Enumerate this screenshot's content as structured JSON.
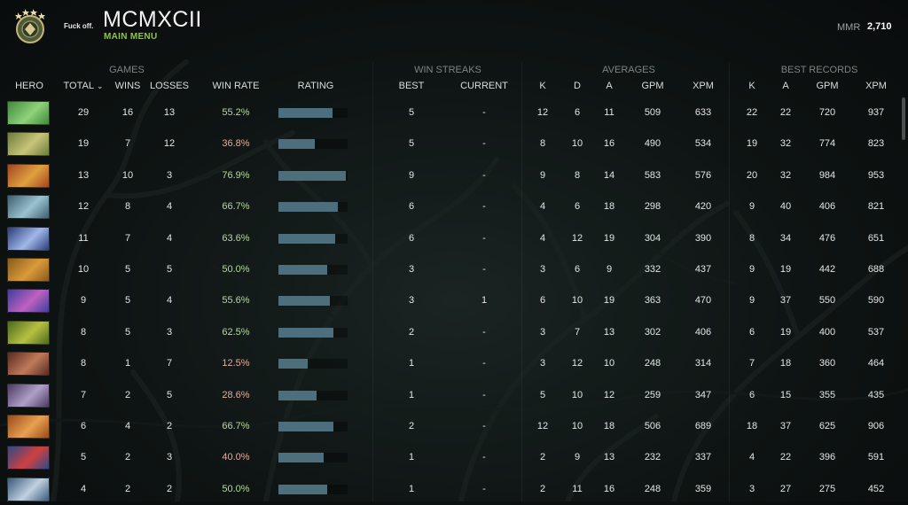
{
  "header": {
    "username_small": "Fuck off.",
    "title": "MCMXCII",
    "subtitle": "MAIN MENU",
    "mmr_label": "MMR",
    "mmr_value": "2,710"
  },
  "groups": {
    "games": "GAMES",
    "win_streaks": "WIN STREAKS",
    "averages": "AVERAGES",
    "best_records": "BEST RECORDS"
  },
  "columns": {
    "hero": "HERO",
    "total": "TOTAL",
    "wins": "WINS",
    "losses": "LOSSES",
    "win_rate": "WIN RATE",
    "rating": "RATING",
    "best": "BEST",
    "current": "CURRENT",
    "avg_k": "K",
    "avg_d": "D",
    "avg_a": "A",
    "avg_gpm": "GPM",
    "avg_xpm": "XPM",
    "best_k": "K",
    "best_a": "A",
    "best_gpm": "GPM",
    "best_xpm": "XPM"
  },
  "colors": {
    "accent_green": "#8ec63f",
    "rating_bar": "#4d6e7c"
  },
  "rows": [
    {
      "hero_colors": [
        "#3f8a3a",
        "#8fd27a"
      ],
      "total": "29",
      "wins": "16",
      "losses": "13",
      "win_rate": "55.2%",
      "rating": 0.78,
      "best": "5",
      "current": "-",
      "k": "12",
      "d": "6",
      "a": "11",
      "gpm": "509",
      "xpm": "633",
      "bk": "22",
      "ba": "22",
      "bgpm": "720",
      "bxpm": "937"
    },
    {
      "hero_colors": [
        "#6b7d3a",
        "#c9c47a"
      ],
      "total": "19",
      "wins": "7",
      "losses": "12",
      "win_rate": "36.8%",
      "rating": 0.52,
      "best": "5",
      "current": "-",
      "k": "8",
      "d": "10",
      "a": "16",
      "gpm": "490",
      "xpm": "534",
      "bk": "19",
      "ba": "32",
      "bgpm": "774",
      "bxpm": "823"
    },
    {
      "hero_colors": [
        "#a3451f",
        "#e0a040"
      ],
      "total": "13",
      "wins": "10",
      "losses": "3",
      "win_rate": "76.9%",
      "rating": 0.98,
      "best": "9",
      "current": "-",
      "k": "9",
      "d": "8",
      "a": "14",
      "gpm": "583",
      "xpm": "576",
      "bk": "20",
      "ba": "32",
      "bgpm": "984",
      "bxpm": "953"
    },
    {
      "hero_colors": [
        "#3c5f70",
        "#9bc2d0"
      ],
      "total": "12",
      "wins": "8",
      "losses": "4",
      "win_rate": "66.7%",
      "rating": 0.86,
      "best": "6",
      "current": "-",
      "k": "4",
      "d": "6",
      "a": "18",
      "gpm": "298",
      "xpm": "420",
      "bk": "9",
      "ba": "40",
      "bgpm": "406",
      "bxpm": "821"
    },
    {
      "hero_colors": [
        "#2c3c7a",
        "#a0b8e8"
      ],
      "total": "11",
      "wins": "7",
      "losses": "4",
      "win_rate": "63.6%",
      "rating": 0.82,
      "best": "6",
      "current": "-",
      "k": "4",
      "d": "12",
      "a": "19",
      "gpm": "304",
      "xpm": "390",
      "bk": "8",
      "ba": "34",
      "bgpm": "476",
      "bxpm": "651"
    },
    {
      "hero_colors": [
        "#8a5a1c",
        "#d99a3a"
      ],
      "total": "10",
      "wins": "5",
      "losses": "5",
      "win_rate": "50.0%",
      "rating": 0.7,
      "best": "3",
      "current": "-",
      "k": "3",
      "d": "6",
      "a": "9",
      "gpm": "332",
      "xpm": "437",
      "bk": "9",
      "ba": "19",
      "bgpm": "442",
      "bxpm": "688"
    },
    {
      "hero_colors": [
        "#3a3fa0",
        "#c060c0"
      ],
      "total": "9",
      "wins": "5",
      "losses": "4",
      "win_rate": "55.6%",
      "rating": 0.74,
      "best": "3",
      "current": "1",
      "k": "6",
      "d": "10",
      "a": "19",
      "gpm": "363",
      "xpm": "470",
      "bk": "9",
      "ba": "37",
      "bgpm": "550",
      "bxpm": "590"
    },
    {
      "hero_colors": [
        "#4a6a1f",
        "#b8c040"
      ],
      "total": "8",
      "wins": "5",
      "losses": "3",
      "win_rate": "62.5%",
      "rating": 0.79,
      "best": "2",
      "current": "-",
      "k": "3",
      "d": "7",
      "a": "13",
      "gpm": "302",
      "xpm": "406",
      "bk": "6",
      "ba": "19",
      "bgpm": "400",
      "bxpm": "537"
    },
    {
      "hero_colors": [
        "#5a2a20",
        "#c07a5a"
      ],
      "total": "8",
      "wins": "1",
      "losses": "7",
      "win_rate": "12.5%",
      "rating": 0.42,
      "best": "1",
      "current": "-",
      "k": "3",
      "d": "12",
      "a": "10",
      "gpm": "248",
      "xpm": "314",
      "bk": "7",
      "ba": "18",
      "bgpm": "360",
      "bxpm": "464"
    },
    {
      "hero_colors": [
        "#4a3a60",
        "#b0a0c8"
      ],
      "total": "7",
      "wins": "2",
      "losses": "5",
      "win_rate": "28.6%",
      "rating": 0.55,
      "best": "1",
      "current": "-",
      "k": "5",
      "d": "10",
      "a": "12",
      "gpm": "259",
      "xpm": "347",
      "bk": "6",
      "ba": "15",
      "bgpm": "355",
      "bxpm": "435"
    },
    {
      "hero_colors": [
        "#9a4a1a",
        "#e8a050"
      ],
      "total": "6",
      "wins": "4",
      "losses": "2",
      "win_rate": "66.7%",
      "rating": 0.79,
      "best": "2",
      "current": "-",
      "k": "12",
      "d": "10",
      "a": "18",
      "gpm": "506",
      "xpm": "689",
      "bk": "18",
      "ba": "37",
      "bgpm": "625",
      "bxpm": "906"
    },
    {
      "hero_colors": [
        "#2a4a8a",
        "#d04040"
      ],
      "total": "5",
      "wins": "2",
      "losses": "3",
      "win_rate": "40.0%",
      "rating": 0.65,
      "best": "1",
      "current": "-",
      "k": "2",
      "d": "9",
      "a": "13",
      "gpm": "232",
      "xpm": "337",
      "bk": "4",
      "ba": "22",
      "bgpm": "396",
      "bxpm": "591"
    },
    {
      "hero_colors": [
        "#3a5a7a",
        "#c0d0e0"
      ],
      "total": "4",
      "wins": "2",
      "losses": "2",
      "win_rate": "50.0%",
      "rating": 0.7,
      "best": "1",
      "current": "-",
      "k": "2",
      "d": "11",
      "a": "16",
      "gpm": "248",
      "xpm": "359",
      "bk": "3",
      "ba": "27",
      "bgpm": "275",
      "bxpm": "452"
    }
  ]
}
